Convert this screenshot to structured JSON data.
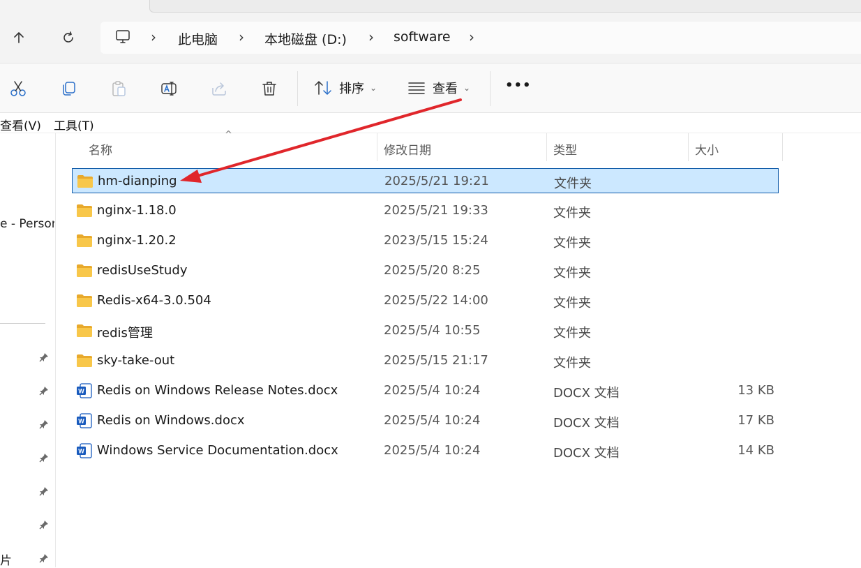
{
  "breadcrumb": {
    "items": [
      "此电脑",
      "本地磁盘 (D:)",
      "software"
    ]
  },
  "toolbar": {
    "sort_label": "排序",
    "view_label": "查看",
    "more_label": "•••"
  },
  "menu": {
    "items": [
      "查看(V)",
      "工具(T)"
    ]
  },
  "left_pane": {
    "item_partial": "e - Person",
    "bottom_partial": "片"
  },
  "columns": {
    "name": "名称",
    "date": "修改日期",
    "type": "类型",
    "size": "大小"
  },
  "files": [
    {
      "name": "hm-dianping",
      "date": "2025/5/21 19:21",
      "type": "文件夹",
      "size": "",
      "kind": "folder-icon",
      "selected": true
    },
    {
      "name": "nginx-1.18.0",
      "date": "2025/5/21 19:33",
      "type": "文件夹",
      "size": "",
      "kind": "folder-icon"
    },
    {
      "name": "nginx-1.20.2",
      "date": "2023/5/15 15:24",
      "type": "文件夹",
      "size": "",
      "kind": "folder-icon"
    },
    {
      "name": "redisUseStudy",
      "date": "2025/5/20 8:25",
      "type": "文件夹",
      "size": "",
      "kind": "folder-icon"
    },
    {
      "name": "Redis-x64-3.0.504",
      "date": "2025/5/22 14:00",
      "type": "文件夹",
      "size": "",
      "kind": "folder-icon"
    },
    {
      "name": "redis管理",
      "date": "2025/5/4 10:55",
      "type": "文件夹",
      "size": "",
      "kind": "folder-icon"
    },
    {
      "name": "sky-take-out",
      "date": "2025/5/15 21:17",
      "type": "文件夹",
      "size": "",
      "kind": "folder-icon"
    },
    {
      "name": "Redis on Windows Release Notes.docx",
      "date": "2025/5/4 10:24",
      "type": "DOCX 文档",
      "size": "13 KB",
      "kind": "word-doc-icon"
    },
    {
      "name": "Redis on Windows.docx",
      "date": "2025/5/4 10:24",
      "type": "DOCX 文档",
      "size": "17 KB",
      "kind": "word-doc-icon"
    },
    {
      "name": "Windows Service Documentation.docx",
      "date": "2025/5/4 10:24",
      "type": "DOCX 文档",
      "size": "14 KB",
      "kind": "word-doc-icon"
    }
  ],
  "colors": {
    "selection_bg": "#cce8ff",
    "selection_border": "#0f5aa8",
    "annotation_arrow": "#e0262b",
    "folder": "#f8c74a",
    "word": "#185abd"
  }
}
